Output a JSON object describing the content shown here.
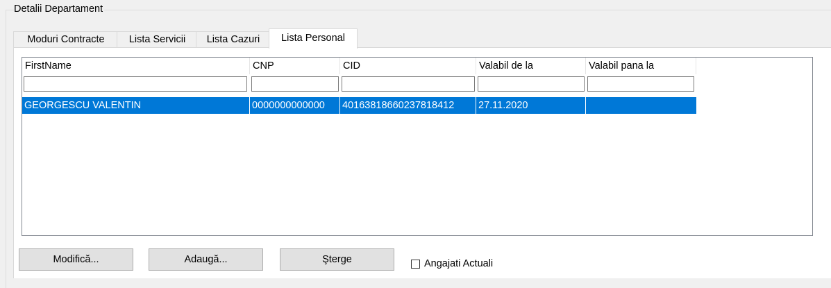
{
  "group": {
    "title": "Detalii Departament"
  },
  "tabs": [
    {
      "label": "Moduri Contracte"
    },
    {
      "label": "Lista Servicii"
    },
    {
      "label": "Lista Cazuri"
    },
    {
      "label": "Lista Personal",
      "active": true
    }
  ],
  "grid": {
    "columns": [
      "FirstName",
      "CNP",
      "CID",
      "Valabil de la",
      "Valabil pana la"
    ],
    "filters": [
      "",
      "",
      "",
      "",
      ""
    ],
    "rows": [
      {
        "cells": [
          "GEORGESCU VALENTIN",
          "0000000000000",
          "40163818660237818412",
          "27.11.2020",
          ""
        ],
        "selected": true
      }
    ]
  },
  "buttons": {
    "modify": "Modifică...",
    "add": "Adaugă...",
    "delete": "Şterge"
  },
  "checkbox": {
    "label": "Angajati Actuali",
    "checked": false
  },
  "colors": {
    "selection": "#0078d7",
    "background": "#f0f0f0"
  }
}
